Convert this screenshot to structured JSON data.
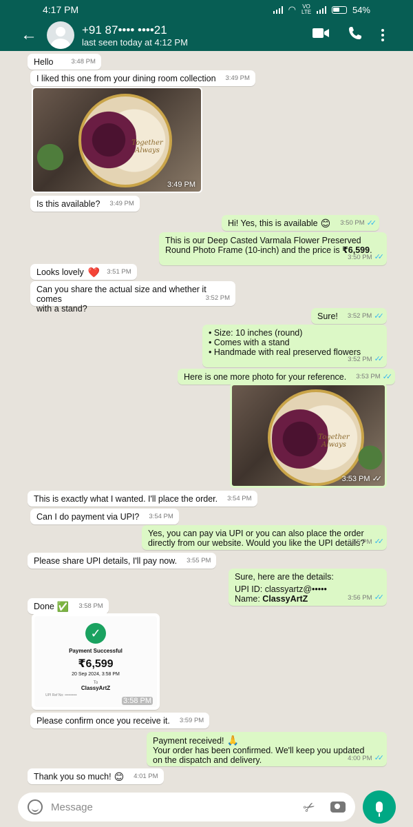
{
  "status": {
    "time": "4:17 PM",
    "battery": "54%",
    "net": "VO LTE"
  },
  "header": {
    "name": "+91 87•••• ••••21",
    "seen": "last seen today at 4:12 PM"
  },
  "messages": [
    {
      "text": "Hello",
      "time": "3:48 PM"
    },
    {
      "text": "I liked this one from your dining room collection",
      "time": "3:49 PM"
    },
    {
      "photo_time": "3:49 PM",
      "caption": "Together Always"
    },
    {
      "text": "Is this available?",
      "time": "3:49 PM"
    },
    {
      "text": "Hi! Yes, this is available",
      "emoji": "😊",
      "time": "3:50 PM"
    },
    {
      "text_a": "This is our Deep Casted Varmala Flower Preserved",
      "text_b": "Round Photo Frame (10-inch) and the price is ",
      "price": "₹6,599",
      "text_c": ".",
      "time": "3:50 PM"
    },
    {
      "text": "Looks lovely",
      "emoji": "❤️",
      "time": "3:51 PM"
    },
    {
      "text_a": "Can you share the actual size and whether it comes",
      "text_b": "with a stand?",
      "time": "3:52 PM"
    },
    {
      "text": "Sure!",
      "time": "3:52 PM"
    },
    {
      "l1": "• Size: 10 inches (round)",
      "l2": "• Comes with a stand",
      "l3": "• Handmade with real preserved flowers",
      "time": "3:52 PM"
    },
    {
      "text": "Here is one more photo for your reference.",
      "time": "3:53 PM"
    },
    {
      "photo_time": "3:53 PM",
      "caption": "Together Always"
    },
    {
      "text": "This is exactly what I wanted. I'll place the order.",
      "time": "3:54 PM"
    },
    {
      "text": "Can I do payment via UPI?",
      "time": "3:54 PM"
    },
    {
      "text_a": "Yes, you can pay via UPI or you can also place the order",
      "text_b": "directly from our website. Would you like the UPI details?",
      "time": "3:55 PM"
    },
    {
      "text": "Please share UPI details, I'll pay now.",
      "time": "3:55 PM"
    },
    {
      "l1": "Sure, here are the details:",
      "upi_label": "UPI ID: ",
      "upi_value": "classyartz@•••••",
      "name_label": "Name: ",
      "name_value": "ClassyArtZ",
      "time": "3:56 PM"
    },
    {
      "text": "Done",
      "emoji": "✅",
      "time": "3:58 PM"
    },
    {
      "status": "Payment Successful",
      "amount": "₹6,599",
      "datetime": "20 Sep 2024, 3:58 PM",
      "to": "To",
      "to_name": "ClassyArtZ",
      "ref": "UPI Ref No: ••••••••••",
      "time": "3:58 PM"
    },
    {
      "text": "Please confirm once you receive it.",
      "time": "3:59 PM"
    },
    {
      "l1": "Payment received!",
      "emoji": "🙏",
      "l2": "Your order has been confirmed. We'll keep you updated",
      "l3": "on the dispatch and delivery.",
      "time": "4:00 PM"
    },
    {
      "text": "Thank you so much!",
      "emoji": "😊",
      "time": "4:01 PM"
    }
  ],
  "input": {
    "placeholder": "Message"
  },
  "icons": [
    "back-arrow-icon",
    "video-call-icon",
    "phone-icon",
    "more-options-icon",
    "emoji-icon",
    "attach-icon",
    "camera-icon",
    "mic-icon",
    "read-ticks-icon"
  ],
  "colors": {
    "header": "#075e54",
    "outgoing": "#dcf8c6",
    "incoming": "#ffffff",
    "ticks": "#34b7f1",
    "mic": "#00a884"
  }
}
